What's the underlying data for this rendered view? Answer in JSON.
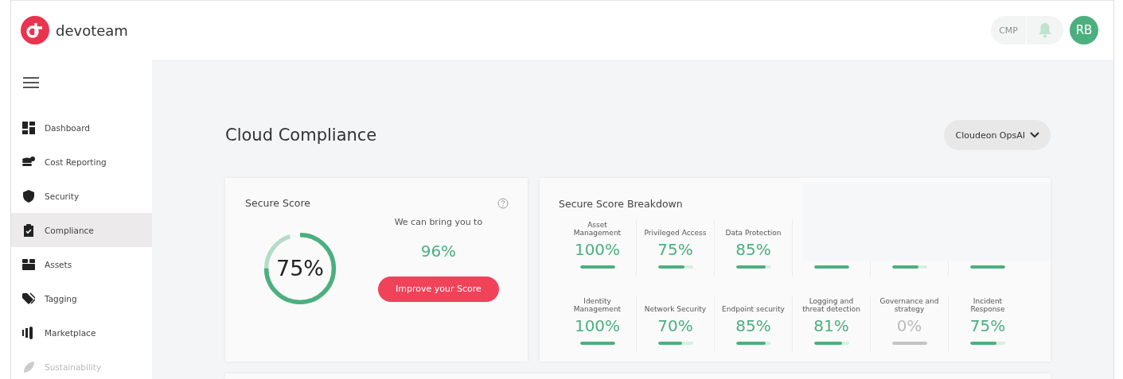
{
  "brand": {
    "name": "devoteam"
  },
  "header": {
    "cmp_label": "CMP",
    "avatar_initials": "RB"
  },
  "sidebar": {
    "items": [
      {
        "label": "Dashboard",
        "selected": false,
        "disabled": false
      },
      {
        "label": "Cost Reporting",
        "selected": false,
        "disabled": false
      },
      {
        "label": "Security",
        "selected": false,
        "disabled": false
      },
      {
        "label": "Compliance",
        "selected": true,
        "disabled": false
      },
      {
        "label": "Assets",
        "selected": false,
        "disabled": false
      },
      {
        "label": "Tagging",
        "selected": false,
        "disabled": false
      },
      {
        "label": "Marketplace",
        "selected": false,
        "disabled": false
      },
      {
        "label": "Sustainability",
        "selected": false,
        "disabled": true
      }
    ]
  },
  "page": {
    "title": "Cloud Compliance",
    "account_selector": "Cloudeon OpsAI"
  },
  "secure_score": {
    "title": "Secure Score",
    "score": "75%",
    "potential_label": "We can bring you to",
    "potential": "96%",
    "button": "Improve your Score"
  },
  "breakdown": {
    "title": "Secure Score Breakdown",
    "rows": [
      [
        {
          "label": "Asset Management",
          "value": "100%",
          "level": 1
        },
        {
          "label": "Privileged Access",
          "value": "75%",
          "level": 0.75
        },
        {
          "label": "Data Protection",
          "value": "85%",
          "level": 0.85
        },
        {
          "level": 1
        },
        {
          "level": 0.75
        },
        {
          "level": 1
        }
      ],
      [
        {
          "label": "Identity Management",
          "value": "100%",
          "level": 1
        },
        {
          "label": "Network Security",
          "value": "70%",
          "level": 0.7
        },
        {
          "label": "Endpoint security",
          "value": "85%",
          "level": 0.85
        },
        {
          "label": "Logging and threat detection",
          "value": "81%",
          "level": 0.81
        },
        {
          "label": "Governance and strategy",
          "value": "0%",
          "level": 0
        },
        {
          "label": "Incident Response",
          "value": "75%",
          "level": 0.75
        }
      ]
    ]
  }
}
